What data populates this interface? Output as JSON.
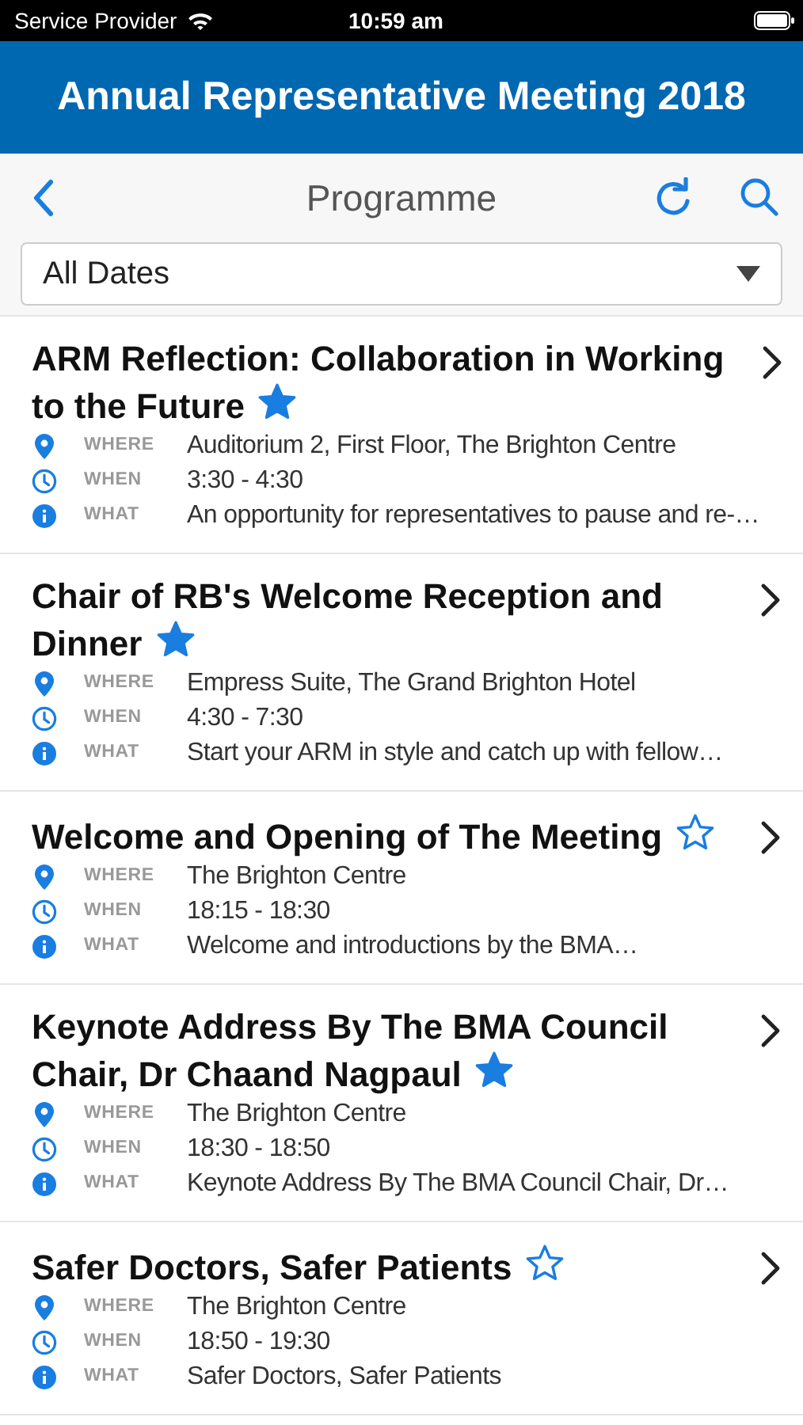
{
  "status_bar": {
    "carrier": "Service Provider",
    "time": "10:59 am"
  },
  "header": {
    "title": "Annual Representative Meeting 2018"
  },
  "nav": {
    "title": "Programme"
  },
  "filter": {
    "value": "All Dates"
  },
  "sessions": [
    {
      "title": "ARM Reflection: Collaboration in Working to the Future",
      "starred": true,
      "where_label": "WHERE",
      "where": "Auditorium 2, First Floor, The Brighton Centre",
      "when_label": "WHEN",
      "when": "3:30 - 4:30",
      "what_label": "WHAT",
      "what": "An opportunity for representatives to pause and re-…"
    },
    {
      "title": "Chair of RB's Welcome Reception and Dinner",
      "starred": true,
      "where_label": "WHERE",
      "where": "Empress Suite, The Grand Brighton Hotel",
      "when_label": "WHEN",
      "when": "4:30 - 7:30",
      "what_label": "WHAT",
      "what": "Start your ARM in style and catch up with fellow…"
    },
    {
      "title": "Welcome and Opening of The Meeting",
      "starred": false,
      "where_label": "WHERE",
      "where": "The Brighton Centre",
      "when_label": "WHEN",
      "when": "18:15 - 18:30",
      "what_label": "WHAT",
      "what": "Welcome and introductions by the BMA…"
    },
    {
      "title": "Keynote Address By The BMA Council Chair, Dr Chaand Nagpaul",
      "starred": true,
      "where_label": "WHERE",
      "where": "The Brighton Centre",
      "when_label": "WHEN",
      "when": "18:30 - 18:50",
      "what_label": "WHAT",
      "what": "Keynote Address By The BMA Council Chair, Dr…"
    },
    {
      "title": "Safer Doctors, Safer Patients",
      "starred": false,
      "where_label": "WHERE",
      "where": "The Brighton Centre",
      "when_label": "WHEN",
      "when": "18:50 - 19:30",
      "what_label": "WHAT",
      "what": "Safer Doctors, Safer Patients"
    }
  ]
}
